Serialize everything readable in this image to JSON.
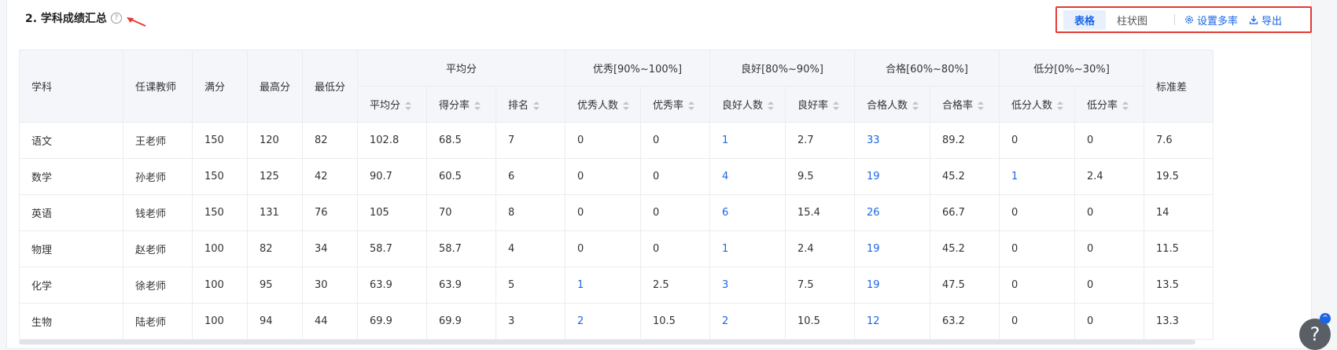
{
  "section": {
    "title": "2. 学科成绩汇总",
    "help_icon": "question-circle-icon"
  },
  "toolbar": {
    "view_table": "表格",
    "view_bar": "柱状图",
    "settings_label": "设置多率",
    "export_label": "导出"
  },
  "table": {
    "headers": {
      "subject": "学科",
      "teacher": "任课教师",
      "full": "满分",
      "max": "最高分",
      "min": "最低分",
      "avg_group": "平均分",
      "excellent_group": "优秀[90%~100%]",
      "good_group": "良好[80%~90%]",
      "pass_group": "合格[60%~80%]",
      "low_group": "低分[0%~30%]",
      "stddev": "标准差",
      "avg": "平均分",
      "score_rate": "得分率",
      "rank": "排名",
      "excellent_count": "优秀人数",
      "excellent_rate": "优秀率",
      "good_count": "良好人数",
      "good_rate": "良好率",
      "pass_count": "合格人数",
      "pass_rate": "合格率",
      "low_count": "低分人数",
      "low_rate": "低分率"
    },
    "rows": [
      {
        "subject": "语文",
        "teacher": "王老师",
        "full": "150",
        "max": "120",
        "min": "82",
        "avg": "102.8",
        "score_rate": "68.5",
        "rank": "7",
        "excellent_count": "0",
        "excellent_rate": "0",
        "good_count": "1",
        "good_rate": "2.7",
        "pass_count": "33",
        "pass_rate": "89.2",
        "low_count": "0",
        "low_rate": "0",
        "stddev": "7.6"
      },
      {
        "subject": "数学",
        "teacher": "孙老师",
        "full": "150",
        "max": "125",
        "min": "42",
        "avg": "90.7",
        "score_rate": "60.5",
        "rank": "6",
        "excellent_count": "0",
        "excellent_rate": "0",
        "good_count": "4",
        "good_rate": "9.5",
        "pass_count": "19",
        "pass_rate": "45.2",
        "low_count": "1",
        "low_rate": "2.4",
        "stddev": "19.5"
      },
      {
        "subject": "英语",
        "teacher": "钱老师",
        "full": "150",
        "max": "131",
        "min": "76",
        "avg": "105",
        "score_rate": "70",
        "rank": "8",
        "excellent_count": "0",
        "excellent_rate": "0",
        "good_count": "6",
        "good_rate": "15.4",
        "pass_count": "26",
        "pass_rate": "66.7",
        "low_count": "0",
        "low_rate": "0",
        "stddev": "14"
      },
      {
        "subject": "物理",
        "teacher": "赵老师",
        "full": "100",
        "max": "82",
        "min": "34",
        "avg": "58.7",
        "score_rate": "58.7",
        "rank": "4",
        "excellent_count": "0",
        "excellent_rate": "0",
        "good_count": "1",
        "good_rate": "2.4",
        "pass_count": "19",
        "pass_rate": "45.2",
        "low_count": "0",
        "low_rate": "0",
        "stddev": "11.5"
      },
      {
        "subject": "化学",
        "teacher": "徐老师",
        "full": "100",
        "max": "95",
        "min": "30",
        "avg": "63.9",
        "score_rate": "63.9",
        "rank": "5",
        "excellent_count": "1",
        "excellent_rate": "2.5",
        "good_count": "3",
        "good_rate": "7.5",
        "pass_count": "19",
        "pass_rate": "47.5",
        "low_count": "0",
        "low_rate": "0",
        "stddev": "13.5"
      },
      {
        "subject": "生物",
        "teacher": "陆老师",
        "full": "100",
        "max": "94",
        "min": "44",
        "avg": "69.9",
        "score_rate": "69.9",
        "rank": "3",
        "excellent_count": "2",
        "excellent_rate": "10.5",
        "good_count": "2",
        "good_rate": "10.5",
        "pass_count": "12",
        "pass_rate": "63.2",
        "low_count": "0",
        "low_rate": "0",
        "stddev": "13.3"
      }
    ]
  },
  "help_fab": {
    "label": "?",
    "badge": "^"
  },
  "colors": {
    "accent": "#1a66e6",
    "highlight": "#e53935"
  }
}
